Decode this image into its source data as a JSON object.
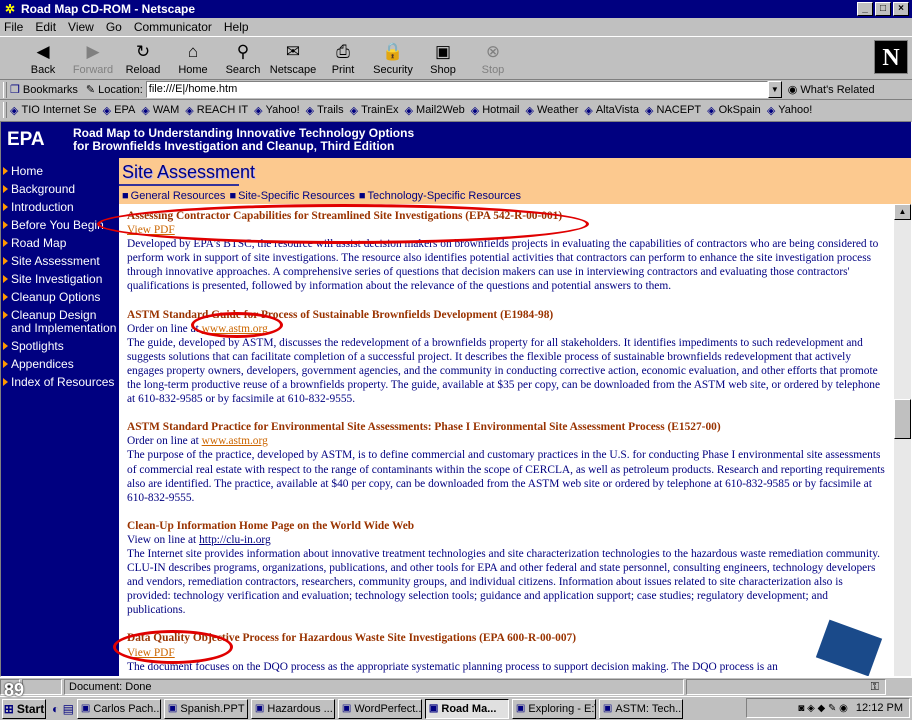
{
  "window": {
    "title": "Road Map CD-ROM - Netscape",
    "controls": [
      "_",
      "□",
      "×"
    ]
  },
  "menu": [
    "File",
    "Edit",
    "View",
    "Go",
    "Communicator",
    "Help"
  ],
  "toolbar": [
    {
      "label": "Back",
      "icon": "back-arrow-icon",
      "glyph": "◀",
      "disabled": false
    },
    {
      "label": "Forward",
      "icon": "forward-arrow-icon",
      "glyph": "▶",
      "disabled": true
    },
    {
      "label": "Reload",
      "icon": "reload-icon",
      "glyph": "↻",
      "disabled": false
    },
    {
      "label": "Home",
      "icon": "home-icon",
      "glyph": "⌂",
      "disabled": false
    },
    {
      "label": "Search",
      "icon": "search-icon",
      "glyph": "⚲",
      "disabled": false
    },
    {
      "label": "Netscape",
      "icon": "netscape-icon",
      "glyph": "✉",
      "disabled": false
    },
    {
      "label": "Print",
      "icon": "print-icon",
      "glyph": "⎙",
      "disabled": false
    },
    {
      "label": "Security",
      "icon": "lock-icon",
      "glyph": "🔒",
      "disabled": false
    },
    {
      "label": "Shop",
      "icon": "shop-icon",
      "glyph": "▣",
      "disabled": false
    },
    {
      "label": "Stop",
      "icon": "stop-icon",
      "glyph": "⊗",
      "disabled": true
    }
  ],
  "netscape_logo": "N",
  "location": {
    "bookmarks_label": "Bookmarks",
    "location_label": "Location:",
    "url": "file:///E|/home.htm",
    "whats_related": "What's Related"
  },
  "personal_toolbar": [
    "TIO Internet Se",
    "EPA",
    "WAM",
    "REACH IT",
    "Yahoo!",
    "Trails",
    "TrainEx",
    "Mail2Web",
    "Hotmail",
    "Weather",
    "AltaVista",
    "NACEPT",
    "OkSpain",
    "Yahoo!"
  ],
  "banner": {
    "logo": "EPA",
    "title_line1": "Road Map to Understanding Innovative Technology Options",
    "title_line2": "for Brownfields Investigation and Cleanup, Third Edition"
  },
  "nav": [
    "Home",
    "Background",
    "Introduction",
    "Before You Begin",
    "Road Map",
    "Site Assessment",
    "Site Investigation",
    "Cleanup Options",
    "Cleanup Design and Implementation",
    "Spotlights",
    "Appendices",
    "Index of Resources"
  ],
  "section": {
    "title": "Site Assessment",
    "tabs": [
      "General Resources",
      "Site-Specific Resources",
      "Technology-Specific Resources"
    ]
  },
  "entries": [
    {
      "title": "Assessing Contractor Capabilities for Streamlined Site Investigations (EPA 542-R-00-001)",
      "link_prefix": "",
      "link": "View PDF",
      "body": "Developed by EPA's BTSC, the resource will assist decision makers on brownfields projects in evaluating the capabilities of contractors who are being considered to perform work in support of site investigations. The resource also identifies potential activities that contractors can perform to enhance the site investigation process through innovative approaches. A comprehensive series of questions that decision makers can use in interviewing contractors and evaluating those contractors' qualifications is presented, followed by information about the relevance of the questions and potential answers to them."
    },
    {
      "title": "ASTM Standard Guide for Process of Sustainable Brownfields Development (E1984-98)",
      "link_prefix": "Order on line at ",
      "link": "www.astm.org",
      "body": "The guide, developed by ASTM, discusses the redevelopment of a brownfields property for all stakeholders. It identifies impediments to such redevelopment and suggests solutions that can facilitate completion of a successful project. It describes the flexible process of sustainable brownfields redevelopment that actively engages property owners, developers, government agencies, and the community in conducting corrective action, economic evaluation, and other efforts that promote the long-term productive reuse of a brownfields property. The guide, available at $35 per copy, can be downloaded from the ASTM web site, or ordered by telephone at 610-832-9585 or by facsimile at 610-832-9555."
    },
    {
      "title": "ASTM Standard Practice for Environmental Site Assessments: Phase I Environmental Site Assessment Process (E1527-00)",
      "link_prefix": "Order on line at ",
      "link": "www.astm.org",
      "body": "The purpose of the practice, developed by ASTM, is to define commercial and customary practices in the U.S. for conducting Phase I environmental site assessments of commercial real estate with respect to the range of contaminants within the scope of CERCLA, as well as petroleum products. Research and reporting requirements also are identified. The practice, available at $40 per copy, can be downloaded from the ASTM web site or ordered by telephone at 610-832-9585 or by facsimile at 610-832-9555."
    },
    {
      "title": "Clean-Up Information Home Page on the World Wide Web",
      "link_prefix": "View on line at ",
      "link": "http://clu-in.org",
      "body": "The Internet site provides information about innovative treatment technologies and site characterization technologies to the hazardous waste remediation community. CLU-IN describes programs, organizations, publications, and other tools for EPA and other federal and state personnel, consulting engineers, technology developers and vendors, remediation contractors, researchers, community groups, and individual citizens. Information about issues related to site characterization also is provided: technology verification and evaluation; technology selection tools; guidance and application support; case studies; regulatory development; and publications."
    },
    {
      "title": "Data Quality Objective Process for Hazardous Waste Site Investigations (EPA 600-R-00-007)",
      "link_prefix": "",
      "link": "View PDF",
      "body": "The document focuses on the DQO process as the appropriate systematic planning process to support decision making. The DQO process is an"
    }
  ],
  "status": {
    "text": "Document: Done"
  },
  "taskbar": {
    "start": "Start",
    "tasks": [
      "Carlos Pach...",
      "Spanish.PPT",
      "Hazardous ...",
      "WordPerfect...",
      "Road Ma...",
      "Exploring - E:\\",
      "ASTM: Tech..."
    ],
    "active_index": 4,
    "clock": "12:12 PM"
  },
  "slide_number": "89",
  "colors": {
    "navy": "#000080",
    "title": "#993300",
    "link": "#cc6600",
    "peach": "#fcc98f",
    "annotation": "#e00000"
  }
}
